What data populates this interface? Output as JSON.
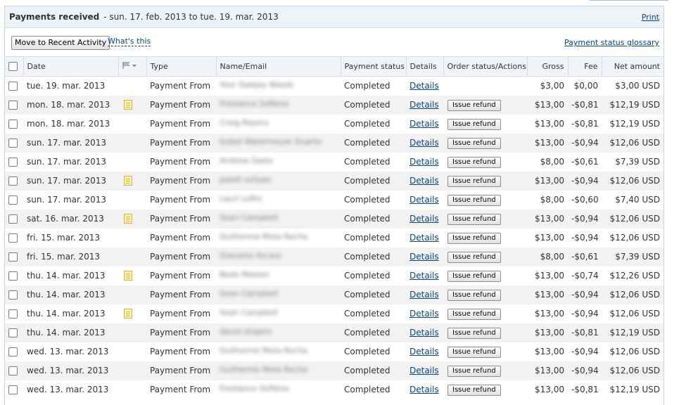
{
  "header": {
    "title": "Payments received",
    "date_range": "- sun. 17. feb. 2013 to tue. 19. mar. 2013",
    "print_label": "Print"
  },
  "toolbar": {
    "move_label": "Move to Recent Activity",
    "whats_this_label": "What's this",
    "glossary_label": "Payment status glossary"
  },
  "columns": {
    "date": "Date",
    "type": "Type",
    "name": "Name/Email",
    "status": "Payment status",
    "details": "Details",
    "order": "Order status/Actions",
    "gross": "Gross",
    "fee": "Fee",
    "net": "Net amount"
  },
  "rows": [
    {
      "date": "tue. 19. mar. 2013",
      "note": false,
      "type": "Payment From",
      "name": "Your Dawjay Needs",
      "status": "Completed",
      "details": "Details",
      "action": "",
      "gross": "$3,00",
      "fee": "$0,00",
      "net": "$3,00 USD"
    },
    {
      "date": "mon. 18. mar. 2013",
      "note": true,
      "type": "Payment From",
      "name": "Freelance Softkiss",
      "status": "Completed",
      "details": "Details",
      "action": "Issue refund",
      "gross": "$13,00",
      "fee": "-$0,81",
      "net": "$12,19 USD"
    },
    {
      "date": "mon. 18. mar. 2013",
      "note": false,
      "type": "Payment From",
      "name": "Craig Rayms",
      "status": "Completed",
      "details": "Details",
      "action": "Issue refund",
      "gross": "$13,00",
      "fee": "-$0,81",
      "net": "$12,19 USD"
    },
    {
      "date": "sun. 17. mar. 2013",
      "note": false,
      "type": "Payment From",
      "name": "Isobel Watermeyer Duarte",
      "status": "Completed",
      "details": "Details",
      "action": "Issue refund",
      "gross": "$13,00",
      "fee": "-$0,94",
      "net": "$12,06 USD"
    },
    {
      "date": "sun. 17. mar. 2013",
      "note": false,
      "type": "Payment From",
      "name": "Andrew Gaels",
      "status": "Completed",
      "details": "Details",
      "action": "Issue refund",
      "gross": "$8,00",
      "fee": "-$0,61",
      "net": "$7,39 USD"
    },
    {
      "date": "sun. 17. mar. 2013",
      "note": true,
      "type": "Payment From",
      "name": "patoll sullyan",
      "status": "Completed",
      "details": "Details",
      "action": "Issue refund",
      "gross": "$13,00",
      "fee": "-$0,94",
      "net": "$12,06 USD"
    },
    {
      "date": "sun. 17. mar. 2013",
      "note": false,
      "type": "Payment From",
      "name": "Lauri Loftis",
      "status": "Completed",
      "details": "Details",
      "action": "Issue refund",
      "gross": "$8,00",
      "fee": "-$0,60",
      "net": "$7,40 USD"
    },
    {
      "date": "sat. 16. mar. 2013",
      "note": true,
      "type": "Payment From",
      "name": "Sean Campbell",
      "status": "Completed",
      "details": "Details",
      "action": "Issue refund",
      "gross": "$13,00",
      "fee": "-$0,94",
      "net": "$12,06 USD"
    },
    {
      "date": "fri. 15. mar. 2013",
      "note": false,
      "type": "Payment From",
      "name": "Guilherme Mota Rocha",
      "status": "Completed",
      "details": "Details",
      "action": "Issue refund",
      "gross": "$13,00",
      "fee": "-$0,94",
      "net": "$12,06 USD"
    },
    {
      "date": "fri. 15. mar. 2013",
      "note": false,
      "type": "Payment From",
      "name": "Giacomo Arcaro",
      "status": "Completed",
      "details": "Details",
      "action": "Issue refund",
      "gross": "$8,00",
      "fee": "-$0,61",
      "net": "$7,39 USD"
    },
    {
      "date": "thu. 14. mar. 2013",
      "note": true,
      "type": "Payment From",
      "name": "Bedo Meisen",
      "status": "Completed",
      "details": "Details",
      "action": "Issue refund",
      "gross": "$13,00",
      "fee": "-$0,74",
      "net": "$12,26 USD"
    },
    {
      "date": "thu. 14. mar. 2013",
      "note": false,
      "type": "Payment From",
      "name": "Sean Campbell",
      "status": "Completed",
      "details": "Details",
      "action": "Issue refund",
      "gross": "$13,00",
      "fee": "-$0,94",
      "net": "$12,06 USD"
    },
    {
      "date": "thu. 14. mar. 2013",
      "note": true,
      "type": "Payment From",
      "name": "Sean Campbell",
      "status": "Completed",
      "details": "Details",
      "action": "Issue refund",
      "gross": "$13,00",
      "fee": "-$0,94",
      "net": "$12,06 USD"
    },
    {
      "date": "thu. 14. mar. 2013",
      "note": false,
      "type": "Payment From",
      "name": "david shapiro",
      "status": "Completed",
      "details": "Details",
      "action": "Issue refund",
      "gross": "$13,00",
      "fee": "-$0,81",
      "net": "$12,19 USD"
    },
    {
      "date": "wed. 13. mar. 2013",
      "note": false,
      "type": "Payment From",
      "name": "Guilherme Mota Rocha",
      "status": "Completed",
      "details": "Details",
      "action": "Issue refund",
      "gross": "$13,00",
      "fee": "-$0,94",
      "net": "$12,06 USD"
    },
    {
      "date": "wed. 13. mar. 2013",
      "note": false,
      "type": "Payment From",
      "name": "Guilherme Mota Rocha",
      "status": "Completed",
      "details": "Details",
      "action": "Issue refund",
      "gross": "$13,00",
      "fee": "-$0,94",
      "net": "$12,06 USD"
    },
    {
      "date": "wed. 13. mar. 2013",
      "note": false,
      "type": "Payment From",
      "name": "Freelance Softkiss",
      "status": "Completed",
      "details": "Details",
      "action": "Issue refund",
      "gross": "$13,00",
      "fee": "-$0,81",
      "net": "$12,19 USD"
    }
  ],
  "colors": {
    "link": "#084482",
    "header_bg": "#eef3f8",
    "row_alt": "#f2f2f2",
    "note_icon": "#fff3b8"
  },
  "icons": {
    "flag_column": "flag-icon",
    "note": "note-icon"
  }
}
